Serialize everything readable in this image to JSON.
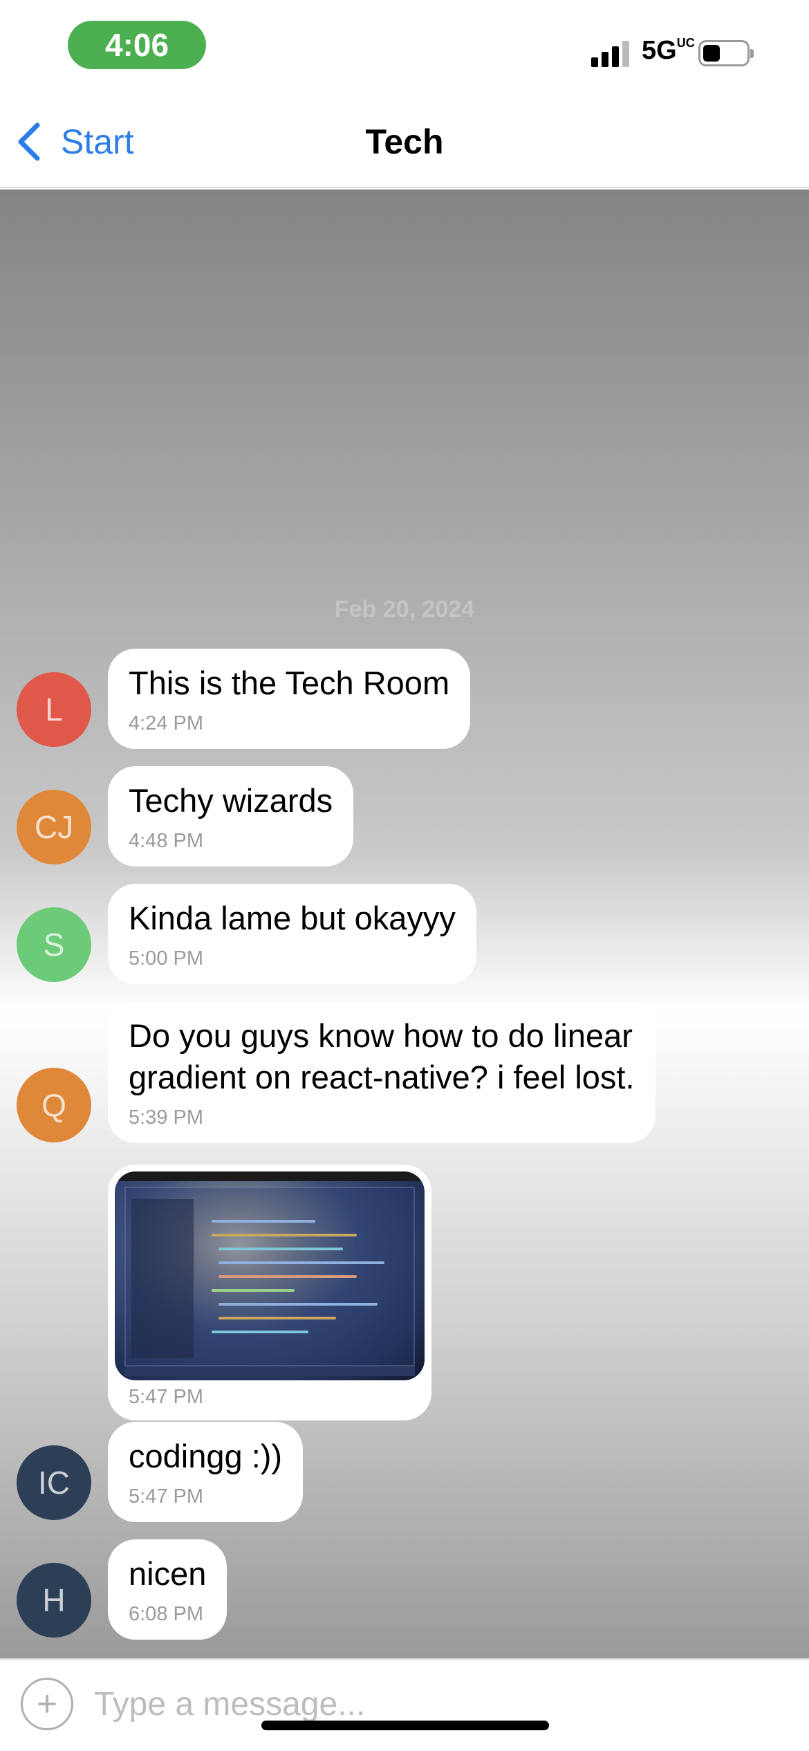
{
  "status_bar": {
    "time": "4:06",
    "network": "5G",
    "network_badge": "UC"
  },
  "nav": {
    "back_label": "Start",
    "title": "Tech"
  },
  "chat": {
    "date": "Feb 20, 2024",
    "messages": [
      {
        "avatar": "L",
        "avatar_color": "#e0584a",
        "text": "This is the Tech Room",
        "time": "4:24 PM"
      },
      {
        "avatar": "CJ",
        "avatar_color": "#e0883a",
        "text": "Techy wizards",
        "time": "4:48 PM"
      },
      {
        "avatar": "S",
        "avatar_color": "#6ccb78",
        "text": "Kinda lame but okayyy",
        "time": "5:00 PM"
      },
      {
        "avatar": "Q",
        "avatar_color": "#e0883a",
        "text_line1": "Do you guys know how to do linear",
        "text_line2": "gradient on react-native? i feel lost.",
        "time": "5:39 PM"
      },
      {
        "type": "image",
        "image_description": "laptop showing code editor",
        "time": "5:47 PM"
      },
      {
        "avatar": "IC",
        "avatar_color": "#2d3e57",
        "text": "codingg :))",
        "time": "5:47 PM"
      },
      {
        "avatar": "H",
        "avatar_color": "#2d3e57",
        "text": "nicen",
        "time": "6:08 PM"
      }
    ]
  },
  "input": {
    "placeholder": "Type a message..."
  },
  "colors": {
    "accent": "#2d7de6",
    "time_pill": "#4caf50"
  }
}
